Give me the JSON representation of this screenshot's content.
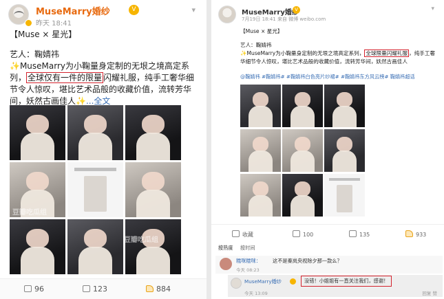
{
  "left_post": {
    "username": "MuseMarry婚纱",
    "time": "昨天 18:41",
    "title": "【Muse × 星光】",
    "artist_line": "艺人：鞠婧祎",
    "text_before": "✨MuseMarry为小鞠量身定制的无垠之境高定系列，",
    "text_highlight": "全球仅有一件的限量",
    "text_after": "闪耀礼服，纯手工奢华细节令人惊叹，堪比艺术品般的收藏价值，流转芳华间，妖然古画佳人✨",
    "more_label": "...全文",
    "watermark": "豆瓣吃瓜组",
    "comments_count": "96",
    "reposts_count": "123",
    "likes_count": "884"
  },
  "right_post": {
    "username": "MuseMarry婚纱",
    "time": "7月19日 18:41 来自 微博 weibo.com",
    "title": "【Muse × 星光】",
    "artist_line": "艺人：鞠婧祎",
    "text_before": "✨MuseMarry为小鞠量身定制的无垠之境高定系列，",
    "text_highlight": "全球限量闪耀礼服",
    "text_after": "，纯手工奢华细节令人惊叹，堪比艺术品般的收藏价值，流转芳华间，妖然古画佳人",
    "tags": "@鞠婧祎 #鞠婧祎# #鞠婧祎白色亮片纱裙# #鞠婧祎东方风云榜# 鞠婧祎超话",
    "favorite_label": "收藏",
    "reposts_count": "100",
    "comments_count": "135",
    "likes_count": "933",
    "sort_hot": "按热度",
    "sort_time": "按时间",
    "comment1_user": "糯咪糯咪：",
    "comment1_text": "这不是秦岚央视除夕那一款么？",
    "comment1_time": "今天 08:23",
    "comment2_user": "MuseMarry婚纱",
    "comment2_text": "没错！小姐姐有一直关注我们，感谢！",
    "comment2_time": "今天 13:09",
    "comment2_actions": "回复  赞"
  },
  "colors": {
    "highlight_box": "#d3212c",
    "brand_orange": "#e86a0f",
    "link_blue": "#3a6fb5",
    "badge_gold": "#f7b500"
  }
}
